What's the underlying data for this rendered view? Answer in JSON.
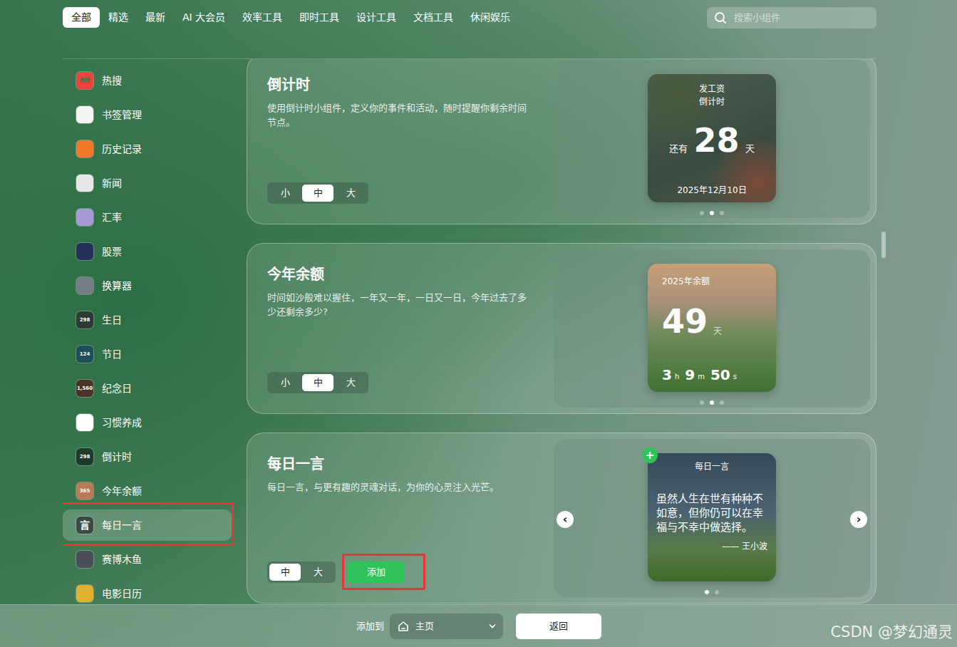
{
  "tabs": [
    {
      "label": "全部",
      "selected": true
    },
    {
      "label": "精选",
      "selected": false
    },
    {
      "label": "最新",
      "selected": false
    },
    {
      "label": "AI 大会员",
      "selected": false
    },
    {
      "label": "效率工具",
      "selected": false
    },
    {
      "label": "即时工具",
      "selected": false
    },
    {
      "label": "设计工具",
      "selected": false
    },
    {
      "label": "文档工具",
      "selected": false
    },
    {
      "label": "休闲娱乐",
      "selected": false
    }
  ],
  "search": {
    "placeholder": "搜索小组件"
  },
  "sidebar": {
    "items": [
      {
        "label": "热搜",
        "icon_text": "热搜",
        "color": "#e8453c",
        "selected": false,
        "annotated": false
      },
      {
        "label": "书签管理",
        "icon_text": "",
        "color": "#f4f4f4",
        "selected": false,
        "annotated": false
      },
      {
        "label": "历史记录",
        "icon_text": "",
        "color": "#f07a2a",
        "selected": false,
        "annotated": false
      },
      {
        "label": "新闻",
        "icon_text": "",
        "color": "#e6e8ea",
        "selected": false,
        "annotated": false
      },
      {
        "label": "汇率",
        "icon_text": "",
        "color": "#a59ad6",
        "selected": false,
        "annotated": false
      },
      {
        "label": "股票",
        "icon_text": "",
        "color": "#26305a",
        "selected": false,
        "annotated": false
      },
      {
        "label": "换算器",
        "icon_text": "",
        "color": "#767c84",
        "selected": false,
        "annotated": false
      },
      {
        "label": "生日",
        "icon_text": "298",
        "color": "#2d3a33",
        "selected": false,
        "annotated": false
      },
      {
        "label": "节日",
        "icon_text": "124",
        "color": "#1f4f5a",
        "selected": false,
        "annotated": false
      },
      {
        "label": "纪念日",
        "icon_text": "1,560",
        "color": "#4a3326",
        "selected": false,
        "annotated": false
      },
      {
        "label": "习惯养成",
        "icon_text": "",
        "color": "#ffffff",
        "selected": false,
        "annotated": false
      },
      {
        "label": "倒计时",
        "icon_text": "298",
        "color": "#1e3a2a",
        "selected": false,
        "annotated": false
      },
      {
        "label": "今年余额",
        "icon_text": "365",
        "color": "#b97a55",
        "selected": false,
        "annotated": false
      },
      {
        "label": "每日一言",
        "icon_text": "言",
        "color": "#3b4a42",
        "selected": true,
        "annotated": true
      },
      {
        "label": "赛博木鱼",
        "icon_text": "",
        "color": "#4a4f55",
        "selected": false,
        "annotated": false
      },
      {
        "label": "电影日历",
        "icon_text": "",
        "color": "#e0b030",
        "selected": false,
        "annotated": false
      }
    ]
  },
  "widgets": [
    {
      "kind": "countdown",
      "title": "倒计时",
      "description": "使用倒计时小组件，定义你的事件和活动，随时提醒你剩余时间节点。",
      "sizes": [
        {
          "label": "小",
          "selected": false
        },
        {
          "label": "中",
          "selected": true
        },
        {
          "label": "大",
          "selected": false
        }
      ],
      "preview": {
        "title": "发工资",
        "subtitle": "倒计时",
        "prefix": "还有",
        "value": "28",
        "unit": "天",
        "date": "2025年12月10日"
      },
      "dots": [
        {
          "selected": false
        },
        {
          "selected": true
        },
        {
          "selected": false
        }
      ]
    },
    {
      "kind": "year",
      "title": "今年余额",
      "description": "时间如沙般难以握住，一年又一年，一日又一日，今年过去了多少还剩余多少?",
      "sizes": [
        {
          "label": "小",
          "selected": false
        },
        {
          "label": "中",
          "selected": true
        },
        {
          "label": "大",
          "selected": false
        }
      ],
      "preview": {
        "title": "2025年余额",
        "value": "49",
        "unit": "天",
        "parts": [
          {
            "value": "3",
            "unit": "h"
          },
          {
            "value": "9",
            "unit": "m"
          },
          {
            "value": "50",
            "unit": "s"
          }
        ]
      },
      "dots": [
        {
          "selected": false
        },
        {
          "selected": true
        },
        {
          "selected": false
        }
      ]
    },
    {
      "kind": "quote",
      "title": "每日一言",
      "description": "每日一言，与更有趣的灵魂对话，为你的心灵注入光芒。",
      "sizes": [
        {
          "label": "中",
          "selected": true
        },
        {
          "label": "大",
          "selected": false
        }
      ],
      "add_button": {
        "label": "添加",
        "annotated": true
      },
      "badge": "+",
      "arrows": {
        "prev": "‹",
        "next": "›"
      },
      "preview": {
        "title": "每日一言",
        "text": "虽然人生在世有种种不如意，但你仍可以在幸福与不幸中做选择。",
        "author": "—— 王小波"
      },
      "dots": [
        {
          "selected": true
        },
        {
          "selected": false
        }
      ]
    }
  ],
  "bottom_bar": {
    "label": "添加到",
    "target": "主页",
    "back": "返回"
  },
  "watermark": "CSDN @梦幻通灵"
}
